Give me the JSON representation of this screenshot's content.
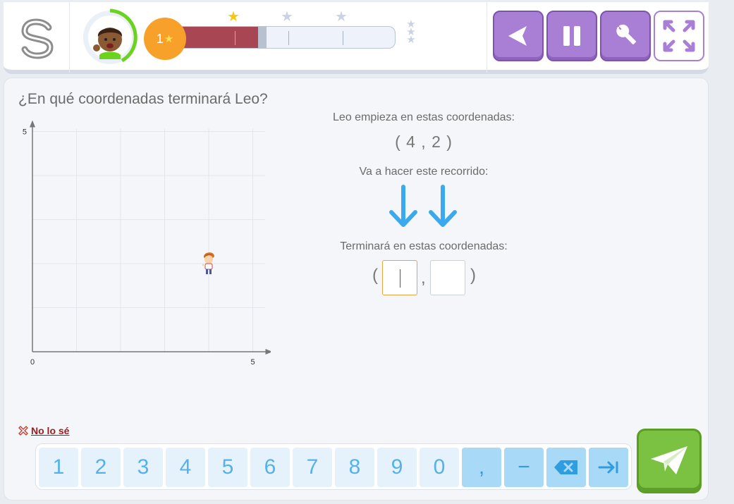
{
  "header": {
    "level": "1",
    "level_star": "★",
    "progress_fraction": 0.36,
    "milestones": [
      {
        "fraction": 0.25,
        "achieved": true
      },
      {
        "fraction": 0.5,
        "achieved": false
      },
      {
        "fraction": 0.75,
        "achieved": false
      }
    ],
    "star_glyph": "★",
    "stacked_star_glyph": "★",
    "colors": {
      "progress_fill": "#a94653",
      "badge": "#f7a12b",
      "tool_button": "#a97fd6"
    },
    "icons": [
      "logo-icon",
      "avatar-icon",
      "back-arrow-icon",
      "pause-icon",
      "wrench-icon",
      "fullscreen-icon"
    ]
  },
  "question": {
    "text": "¿En qué coordenadas terminará Leo?"
  },
  "grid": {
    "x_min_label": "0",
    "x_max_label": "5",
    "y_max_label": "5",
    "range": [
      0,
      5
    ],
    "character_position": [
      4,
      2
    ]
  },
  "info": {
    "start_label": "Leo empieza en estas coordenadas:",
    "start_value": "( 4 , 2 )",
    "path_label": "Va a hacer este recorrido:",
    "moves": [
      "down",
      "down"
    ],
    "end_label": "Terminará en estas coordenadas:",
    "open_paren": "(",
    "comma": ",",
    "close_paren": ")",
    "answer_x": "",
    "answer_y": ""
  },
  "dont_know": {
    "label": "No lo sé"
  },
  "keypad": {
    "digits": [
      "1",
      "2",
      "3",
      "4",
      "5",
      "6",
      "7",
      "8",
      "9",
      "0"
    ],
    "comma": ",",
    "minus": "−",
    "icons": [
      "backspace-icon",
      "tab-next-icon"
    ]
  }
}
